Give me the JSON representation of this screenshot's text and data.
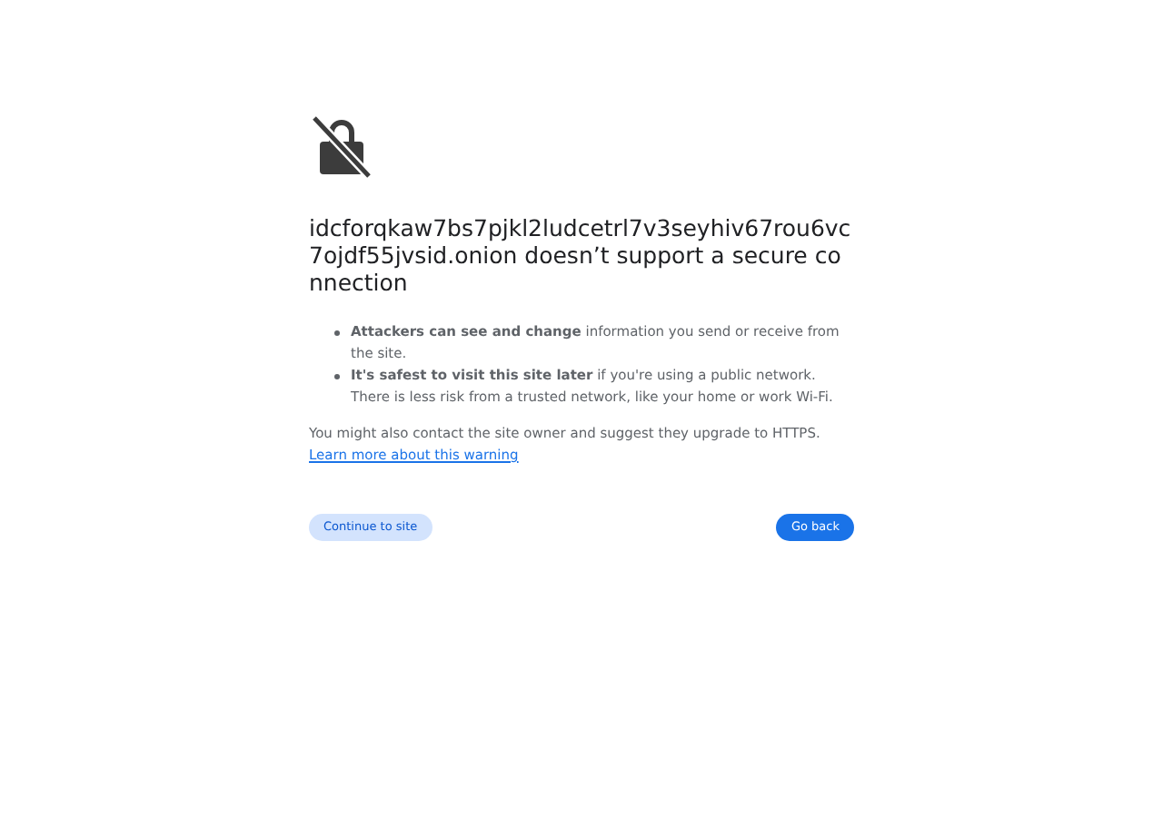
{
  "heading": "idcforqkaw7bs7pjkl2ludcetrl7v3seyhiv67rou6vc7ojdf55jvsid.onion doesn’t support a secure connection",
  "bullets": [
    "**Attackers can see and change** information you send or receive from the site.",
    "**It's safest to visit this site later** if you're using a public network. There is less risk from a trusted network, like your home or work Wi-Fi."
  ],
  "note": "You might also contact the site owner and suggest they upgrade to HTTPS.",
  "link": "Learn more about this warning",
  "buttons": {
    "secondary": "Continue to site",
    "primary": "Go back"
  }
}
